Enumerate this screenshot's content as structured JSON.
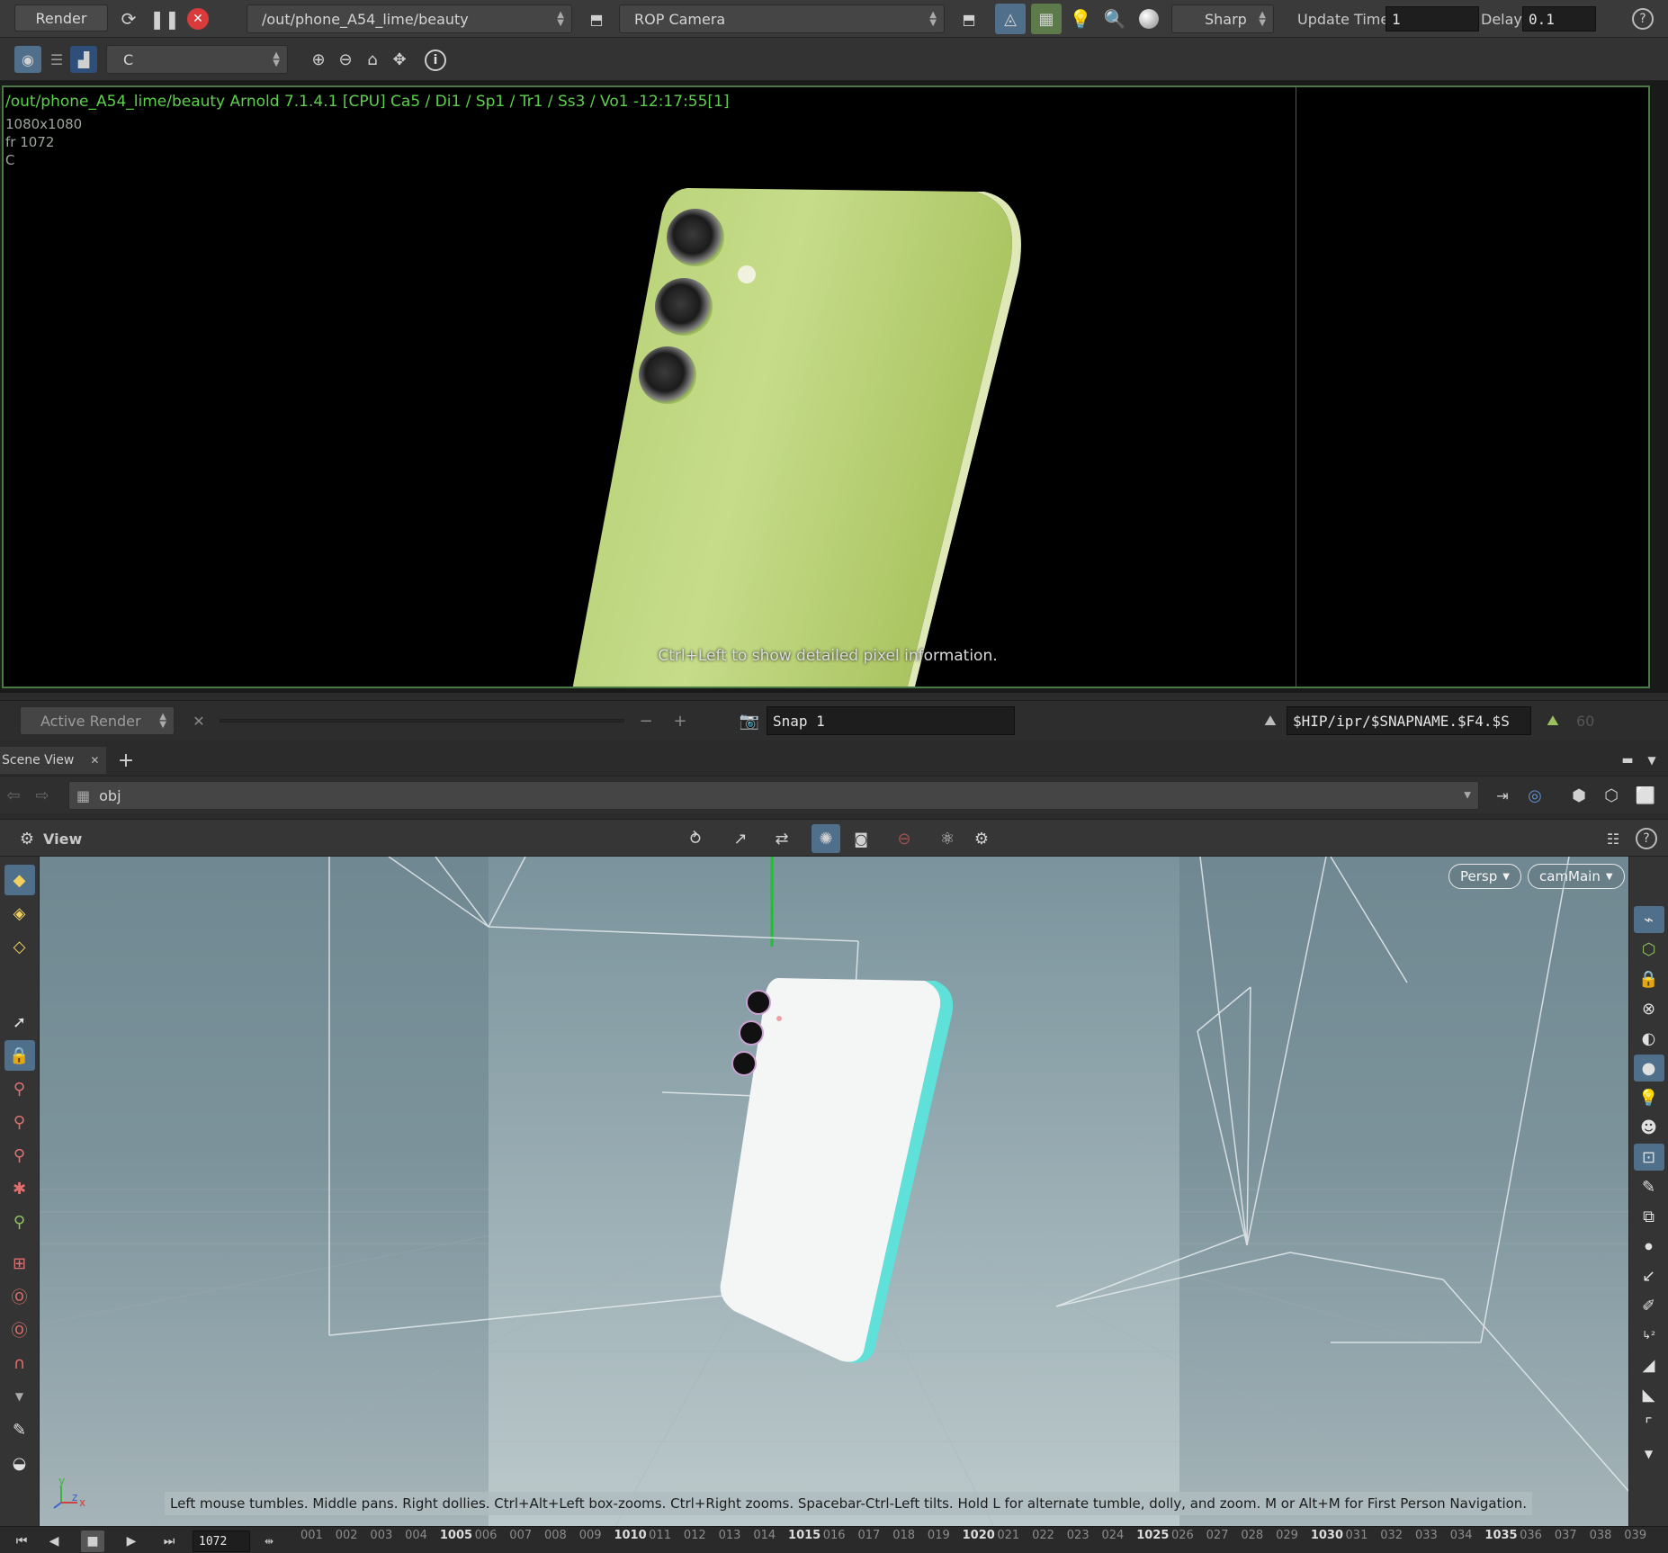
{
  "toolbar": {
    "render_label": "Render",
    "rop_path": "/out/phone_A54_lime/beauty",
    "camera": "ROP Camera",
    "preview_mode": "Sharp",
    "update_time_label": "Update Time",
    "update_time_value": "1",
    "delay_label": "Delay",
    "delay_value": "0.1"
  },
  "toolbar2": {
    "aov": "C"
  },
  "render_view": {
    "info_line": "/out/phone_A54_lime/beauty  Arnold 7.1.4.1 [CPU]  Ca5 / Di1 / Sp1 / Tr1 / Ss3 / Vo1 -12:17:55[1]",
    "resolution": "1080x1080",
    "frame": "fr 1072",
    "plane": "C",
    "hint": "Ctrl+Left to show detailed pixel information."
  },
  "render_bar": {
    "active_render": "Active Render",
    "snapshot": "Snap 1",
    "snapshot_path": "$HIP/ipr/$SNAPNAME.$F4.$S",
    "count": "60"
  },
  "scene": {
    "tab": "Scene View",
    "path": "obj",
    "view_label": "View",
    "persp": "Persp",
    "camera": "camMain",
    "hint": "Left mouse tumbles. Middle pans. Right dollies. Ctrl+Alt+Left box-zooms. Ctrl+Right zooms. Spacebar-Ctrl-Left tilts. Hold L for alternate tumble, dolly, and zoom.    M or Alt+M for First Person Navigation."
  },
  "timeline": {
    "current_frame": "1072",
    "ticks": [
      "001",
      "002",
      "003",
      "004",
      "1005",
      "006",
      "007",
      "008",
      "009",
      "1010",
      "011",
      "012",
      "013",
      "014",
      "1015",
      "016",
      "017",
      "018",
      "019",
      "1020",
      "021",
      "022",
      "023",
      "024",
      "1025",
      "026",
      "027",
      "028",
      "029",
      "1030",
      "031",
      "032",
      "033",
      "034",
      "1035",
      "036",
      "037",
      "038",
      "039"
    ]
  },
  "colors": {
    "render_info": "#5dd04c",
    "border_active": "#4a7a44",
    "phone_lime": "#c6dc8a",
    "selection": "#4f6f8a"
  }
}
